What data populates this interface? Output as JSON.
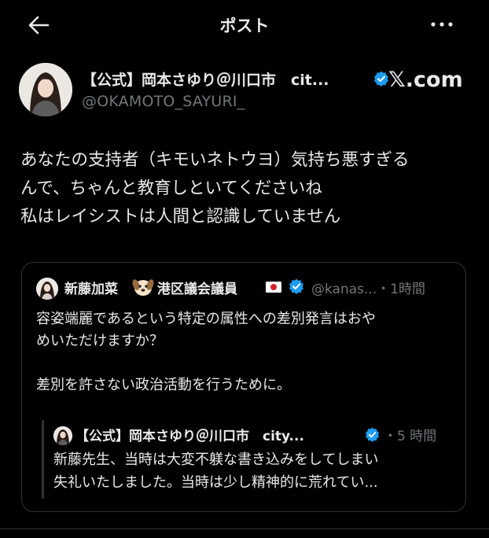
{
  "header": {
    "title": "ポスト",
    "back_icon": "arrow-left-icon",
    "more_icon": "more-horizontal-icon"
  },
  "post": {
    "author_name": "【公式】岡本さゆり＠川口市　cit...",
    "author_handle": "@OKAMOTO_SAYURI_",
    "brand": "𝕏.com",
    "verified_color": "#1d9bf0",
    "text_lines": [
      "あなたの支持者（キモいネトウヨ）気持ち悪すぎる",
      "んで、ちゃんと教育しといてくださいね",
      "私はレイシストは人間と認識していません"
    ]
  },
  "quote": {
    "name_part1": "新藤加菜",
    "name_part2": "港区議会議員",
    "emoji_icon": "dog-face-icon",
    "flag_icon": "japan-flag-icon",
    "handle_time": "@kanas...・1時間",
    "text_lines": [
      "容姿端麗であるという特定の属性への差別発言はおや",
      "めいただけますか？",
      "",
      "差別を許さない政治活動を行うために。"
    ],
    "nested": {
      "author_name": "【公式】岡本さゆり＠川口市　city...",
      "time": "・5 時間",
      "text_lines": [
        "新藤先生、当時は大変不躾な書き込みをしてしまい",
        "失礼いたしました。当時は少し精神的に荒れてい..."
      ]
    }
  }
}
